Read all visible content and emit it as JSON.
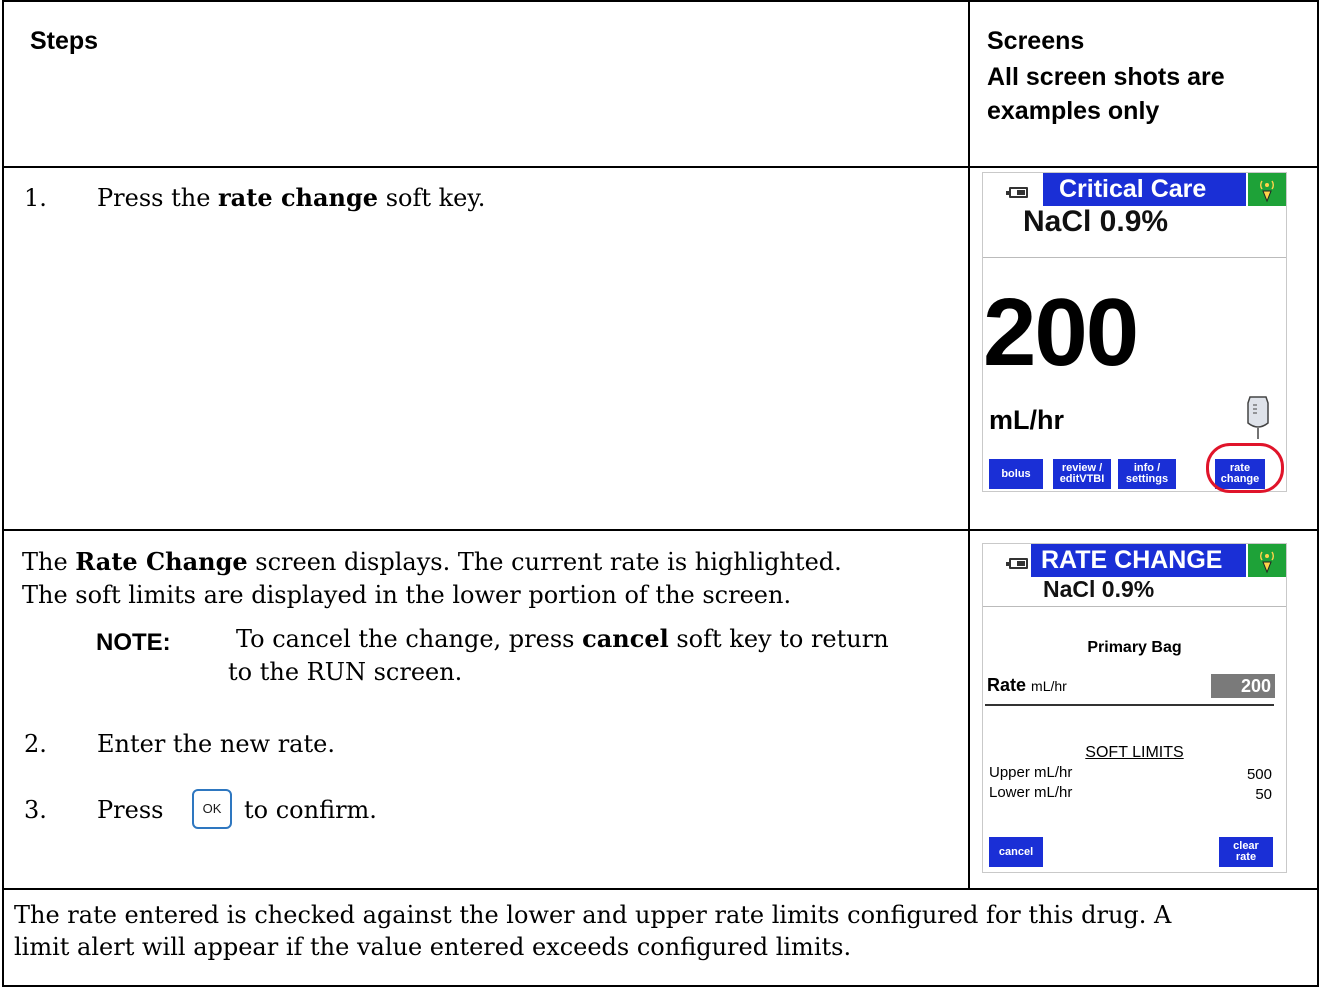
{
  "header": {
    "steps": "Steps",
    "screens_line1": "Screens",
    "screens_line2": "All screen shots are",
    "screens_line3": "examples only"
  },
  "row1": {
    "step_number": "1.",
    "step_pre": "Press the ",
    "step_bold": "rate change",
    "step_post": " soft key."
  },
  "row2": {
    "intro_pre": "The ",
    "intro_bold": "Rate Change",
    "intro_post": " screen displays. The current rate is highlighted.",
    "intro_line2": "The soft limits are displayed in the lower portion of the screen.",
    "note_label": "NOTE:",
    "note_pre": "To cancel the change, press ",
    "note_bold": "cancel",
    "note_post": " soft key to return",
    "note_line2": "to the RUN screen.",
    "step2_number": "2.",
    "step2_text": "Enter the new rate.",
    "step3_number": "3.",
    "step3_pre": "Press",
    "step3_key": "OK",
    "step3_post": "to confirm."
  },
  "row3": {
    "line1": "The rate entered is checked against the lower and upper rate limits configured for this drug. A",
    "line2": "limit alert will appear if the value entered exceeds configured limits."
  },
  "screen1": {
    "title": "Critical Care",
    "drug": "NaCl 0.9%",
    "rate": "200",
    "unit": "mL/hr",
    "soft_keys": [
      "bolus",
      "review /\neditVTBI",
      "info /\nsettings",
      "rate\nchange"
    ],
    "highlight_color": "#e0142a",
    "title_bar_color": "#1a2fd6",
    "wifi_color": "#1ea238"
  },
  "screen2": {
    "title": "RATE CHANGE",
    "drug": "NaCl 0.9%",
    "section": "Primary Bag",
    "rate_label": "Rate",
    "rate_unit": "mL/hr",
    "rate_value": "200",
    "limits_title": "SOFT LIMITS",
    "upper_label": "Upper mL/hr",
    "upper_value": "500",
    "lower_label": "Lower mL/hr",
    "lower_value": "50",
    "cancel_key": "cancel",
    "clear_key": "clear\nrate"
  }
}
